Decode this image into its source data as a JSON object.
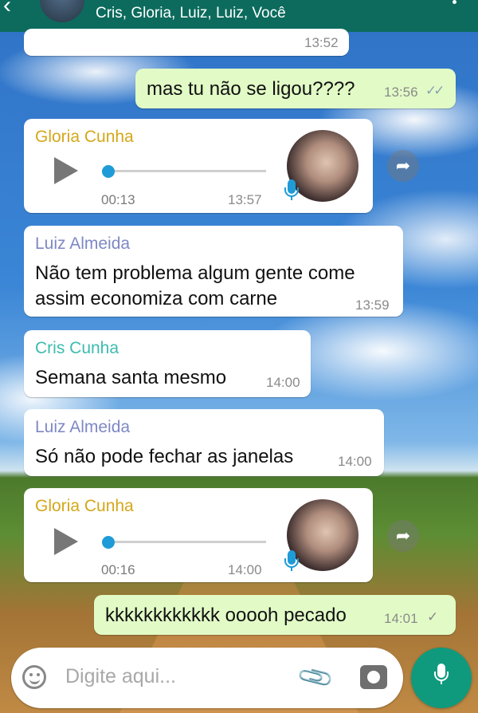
{
  "header": {
    "back_icon": "arrow-left-icon",
    "members": "Cris, Gloria, Luiz, Luiz, Você"
  },
  "messages": [
    {
      "type": "text",
      "direction": "in",
      "time": "13:52"
    },
    {
      "type": "text",
      "direction": "out",
      "text": "mas tu não se ligou????",
      "time": "13:56",
      "status": "read"
    },
    {
      "type": "voice",
      "direction": "in",
      "sender": "Gloria Cunha",
      "sender_color": "#d4a71a",
      "duration": "00:13",
      "time": "13:57",
      "progress": 0
    },
    {
      "type": "text",
      "direction": "in",
      "sender": "Luiz Almeida",
      "sender_color": "#7e88c4",
      "text_line1": "Não tem problema algum gente come",
      "text_line2": "assim economiza com carne",
      "time": "13:59"
    },
    {
      "type": "text",
      "direction": "in",
      "sender": "Cris Cunha",
      "sender_color": "#3dbcae",
      "text": "Semana santa mesmo",
      "time": "14:00"
    },
    {
      "type": "text",
      "direction": "in",
      "sender": "Luiz Almeida",
      "sender_color": "#7e88c4",
      "text": "Só não pode fechar as janelas",
      "time": "14:00"
    },
    {
      "type": "voice",
      "direction": "in",
      "sender": "Gloria Cunha",
      "sender_color": "#d4a71a",
      "duration": "00:16",
      "time": "14:00",
      "progress": 0
    },
    {
      "type": "text",
      "direction": "out",
      "text": "kkkkkkkkkkkk ooooh pecado",
      "time": "14:01",
      "status": "delivered"
    }
  ],
  "input": {
    "placeholder": "Digite aqui...",
    "emoji_icon": "emoji-icon",
    "attach_icon": "paperclip-icon",
    "camera_icon": "camera-icon",
    "mic_icon": "microphone-icon"
  },
  "colors": {
    "header": "#0c6b5d",
    "outgoing": "#e2fbc6",
    "accent": "#0f9a7e",
    "voice_blue": "#1f9bd7"
  }
}
